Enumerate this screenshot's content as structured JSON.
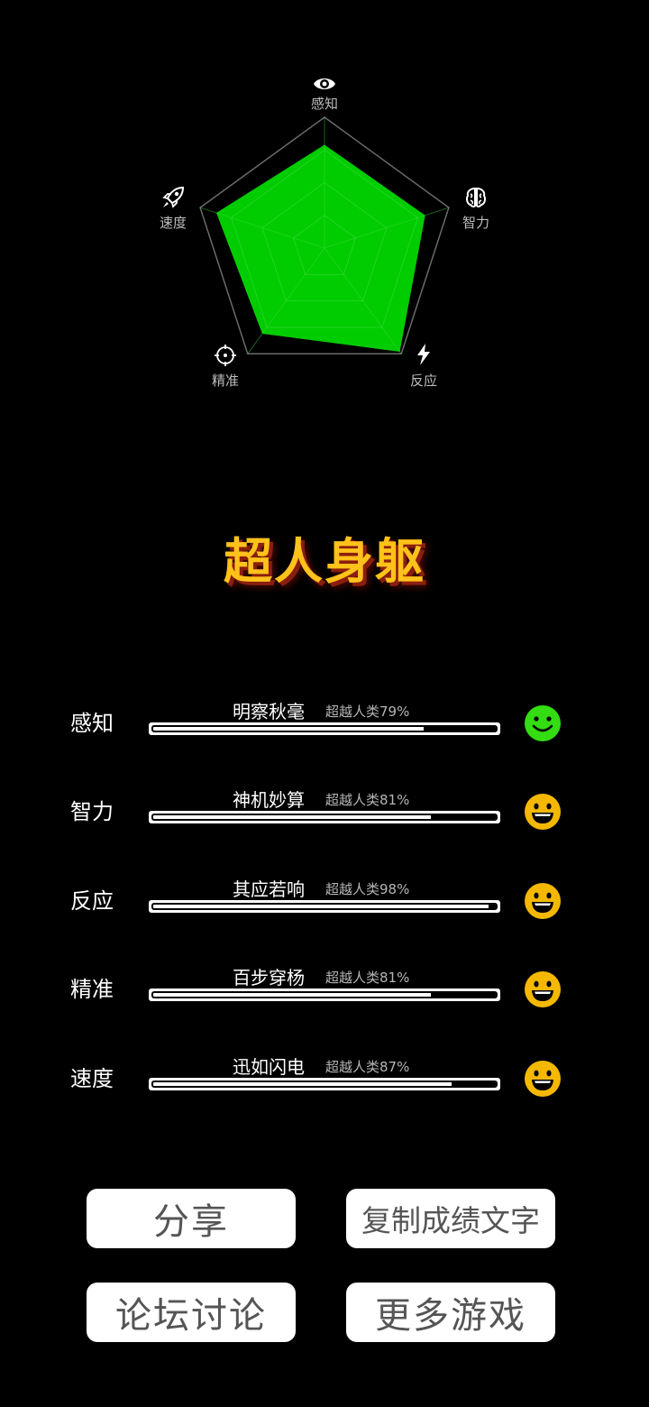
{
  "chart_data": {
    "type": "radar",
    "axes": [
      "感知",
      "智力",
      "反应",
      "精准",
      "速度"
    ],
    "values": [
      79,
      81,
      98,
      81,
      87
    ],
    "max": 100,
    "icons": [
      "eye-icon",
      "brain-icon",
      "lightning-icon",
      "crosshair-icon",
      "rocket-icon"
    ],
    "fill_color": "#00cc00",
    "grid_color": "#6b6b6b"
  },
  "title": "超人身躯",
  "stats": [
    {
      "label": "感知",
      "grade": "明察秋毫",
      "percent_text": "超越人类79%",
      "value": 79,
      "face": "smile",
      "face_color": "#33dd11"
    },
    {
      "label": "智力",
      "grade": "神机妙算",
      "percent_text": "超越人类81%",
      "value": 81,
      "face": "grin",
      "face_color": "#f5b800"
    },
    {
      "label": "反应",
      "grade": "其应若响",
      "percent_text": "超越人类98%",
      "value": 98,
      "face": "grin",
      "face_color": "#f5b800"
    },
    {
      "label": "精准",
      "grade": "百步穿杨",
      "percent_text": "超越人类81%",
      "value": 81,
      "face": "grin",
      "face_color": "#f5b800"
    },
    {
      "label": "速度",
      "grade": "迅如闪电",
      "percent_text": "超越人类87%",
      "value": 87,
      "face": "grin",
      "face_color": "#f5b800"
    }
  ],
  "buttons": {
    "share": "分享",
    "copy": "复制成绩文字",
    "forum": "论坛讨论",
    "more": "更多游戏"
  }
}
